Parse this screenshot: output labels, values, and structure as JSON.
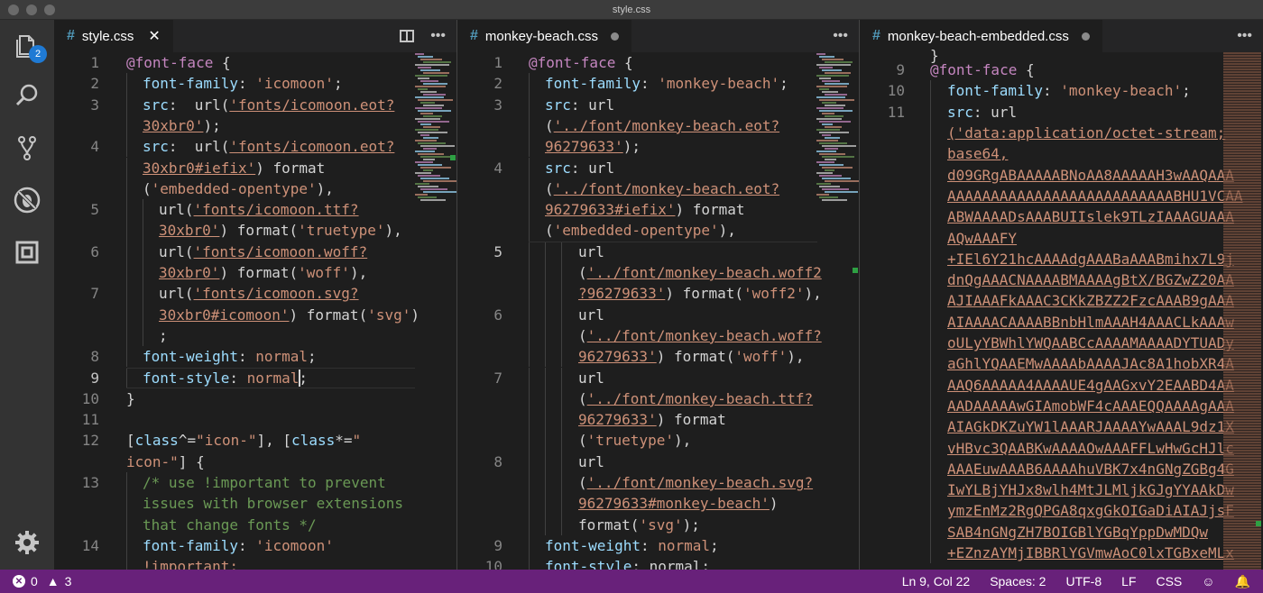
{
  "window": {
    "title": "style.css"
  },
  "activity": {
    "source_control_badge": "2"
  },
  "groups": [
    {
      "tab": {
        "label": "style.css",
        "close": "✕"
      },
      "lines": [
        {
          "n": "1"
        },
        {
          "n": "2"
        },
        {
          "n": "3"
        },
        {
          "n": ""
        },
        {
          "n": "4"
        },
        {
          "n": ""
        },
        {
          "n": ""
        },
        {
          "n": "5"
        },
        {
          "n": ""
        },
        {
          "n": "6"
        },
        {
          "n": ""
        },
        {
          "n": "7"
        },
        {
          "n": ""
        },
        {
          "n": ""
        },
        {
          "n": "8"
        },
        {
          "n": "9"
        },
        {
          "n": "10"
        },
        {
          "n": "11"
        },
        {
          "n": "12"
        },
        {
          "n": ""
        },
        {
          "n": "13"
        },
        {
          "n": ""
        },
        {
          "n": ""
        },
        {
          "n": "14"
        },
        {
          "n": ""
        }
      ]
    },
    {
      "tab": {
        "label": "monkey-beach.css"
      },
      "lines": [
        {
          "n": "1"
        },
        {
          "n": "2"
        },
        {
          "n": "3"
        },
        {
          "n": ""
        },
        {
          "n": ""
        },
        {
          "n": "4"
        },
        {
          "n": ""
        },
        {
          "n": ""
        },
        {
          "n": ""
        },
        {
          "n": "5"
        },
        {
          "n": ""
        },
        {
          "n": ""
        },
        {
          "n": "6"
        },
        {
          "n": ""
        },
        {
          "n": ""
        },
        {
          "n": "7"
        },
        {
          "n": ""
        },
        {
          "n": ""
        },
        {
          "n": ""
        },
        {
          "n": "8"
        },
        {
          "n": ""
        },
        {
          "n": ""
        },
        {
          "n": ""
        },
        {
          "n": "9"
        },
        {
          "n": "10"
        }
      ]
    },
    {
      "tab": {
        "label": "monkey-beach-embedded.css"
      },
      "lines": [
        {
          "n": "9"
        },
        {
          "n": "10"
        },
        {
          "n": "11"
        }
      ]
    }
  ],
  "code1": {
    "l1a": "@font-face",
    "l1b": " {",
    "l2a": "font-family",
    "l2b": ": ",
    "l2c": "'icomoon'",
    "l2d": ";",
    "l3a": "src",
    "l3b": ":  url(",
    "l3c": "'fonts/icomoon.eot?",
    "l3d": "30xbr0'",
    "l3e": ");",
    "l4a": "src",
    "l4b": ":  url(",
    "l4c": "'fonts/icomoon.eot?",
    "l4d": "30xbr0#iefix'",
    "l4e": ") format",
    "l4f": "(",
    "l4g": "'embedded-opentype'",
    "l4h": "),",
    "l5a": "url(",
    "l5b": "'fonts/icomoon.ttf?",
    "l5c": "30xbr0'",
    "l5d": ") format(",
    "l5e": "'truetype'",
    "l5f": "),",
    "l6a": "url(",
    "l6b": "'fonts/icomoon.woff?",
    "l6c": "30xbr0'",
    "l6d": ") format(",
    "l6e": "'woff'",
    "l6f": "),",
    "l7a": "url(",
    "l7b": "'fonts/icomoon.svg?",
    "l7c": "30xbr0#icomoon'",
    "l7d": ") format(",
    "l7e": "'svg'",
    "l7f": ")",
    "l7g": ";",
    "l8a": "font-weight",
    "l8b": ": ",
    "l8c": "normal",
    "l8d": ";",
    "l9a": "font-style",
    "l9b": ": ",
    "l9c": "normal",
    "l9d": ";",
    "l10": "}",
    "l12a": "[",
    "l12b": "class",
    "l12c": "^=",
    "l12d": "\"icon-\"",
    "l12e": "], [",
    "l12f": "class",
    "l12g": "*=",
    "l12h": "\"",
    "l12i": "icon-\"",
    "l12j": "] {",
    "l13a": "/* use !important to prevent",
    "l13b": "issues with browser extensions",
    "l13c": "that change fonts */",
    "l14a": "font-family",
    "l14b": ": ",
    "l14c": "'icomoon'",
    "l14d": "!important;"
  },
  "code2": {
    "l1a": "@font-face",
    "l1b": " {",
    "l2a": "font-family",
    "l2b": ": ",
    "l2c": "'monkey-beach'",
    "l2d": ";",
    "l3a": "src",
    "l3b": ": url",
    "l3c": "(",
    "l3d": "'../font/monkey-beach.eot?",
    "l3e": "96279633'",
    "l3f": ");",
    "l4a": "src",
    "l4b": ": url",
    "l4c": "(",
    "l4d": "'../font/monkey-beach.eot?",
    "l4e": "96279633#iefix'",
    "l4f": ") format",
    "l4g": "(",
    "l4h": "'embedded-opentype'",
    "l4i": "),",
    "l5a": "url",
    "l5b": "(",
    "l5c": "'../font/monkey-beach.woff2",
    "l5d": "?96279633'",
    "l5e": ") format(",
    "l5f": "'woff2'",
    "l5g": "),",
    "l6a": "url",
    "l6b": "(",
    "l6c": "'../font/monkey-beach.woff?",
    "l6d": "96279633'",
    "l6e": ") format(",
    "l6f": "'woff'",
    "l6g": "),",
    "l7a": "url",
    "l7b": "(",
    "l7c": "'../font/monkey-beach.ttf?",
    "l7d": "96279633'",
    "l7e": ") format",
    "l7f": "(",
    "l7g": "'truetype'",
    "l7h": "),",
    "l8a": "url",
    "l8b": "(",
    "l8c": "'../font/monkey-beach.svg?",
    "l8d": "96279633#monkey-beach'",
    "l8e": ")",
    "l8f": "format(",
    "l8g": "'svg'",
    "l8h": ");",
    "l9a": "font-weight",
    "l9b": ": ",
    "l9c": "normal",
    "l9d": ";",
    "l10a": "font-style",
    "l10b": ": normal;"
  },
  "code3": {
    "top": "}",
    "l9a": "@font-face",
    "l9b": " {",
    "l10a": "font-family",
    "l10b": ": ",
    "l10c": "'monkey-beach'",
    "l10d": ";",
    "l11a": "src",
    "l11b": ": url",
    "data": [
      "('data:application/octet-stream;",
      "base64,",
      "d09GRgABAAAAABNoAA8AAAAAH3wAAQAAA",
      "AAAAAAAAAAAAAAAAAAAAAAAAAABHU1VCAA",
      "ABWAAAADsAAABUIIslek9TLzIAAAGUAAA",
      "AQwAAAFY",
      "+IEl6Y21hcAAAAdgAAABaAAABmihx7L9j",
      "dnQgAAACNAAAABMAAAAgBtX/BGZwZ20AA",
      "AJIAAAFkAAAC3CKkZBZZ2FzcAAAB9gAAA",
      "AIAAAACAAAABBnbHlmAAAH4AAACLkAAAw",
      "oULyYBWhlYWQAABCcAAAAMAAAADYTUADy",
      "aGhlYQAAEMwAAAAbAAAAJAc8A1hobXR4A",
      "AAQ6AAAAA4AAAAUE4gAAGxvY2EAABD4AA",
      "AADAAAAAwGIAmobWF4cAAAEQQAAAAgAAA",
      "AIAGkDKZuYW1lAAARJAAAAYwAAAL9dz1X",
      "vHBvc3QAABKwAAAAOwAAAFFLwHwGcHJlc",
      "AAAEuwAAAB6AAAAhuVBK7x4nGNgZGBg4G",
      "IwYLBjYHJx8wlh4MtJLMljkGJgYYAAkDw",
      "ymzEnMz2RgQPGA8qxgGkOIGaDiAIAJjsF",
      "SAB4nGNgZH7BOIGBlYGBqYppDwMDQw",
      "+EZnzAYMjIBBRlYGVmwAoC0lxTGBxeMLx"
    ]
  },
  "status": {
    "errors": "0",
    "warnings": "3",
    "position": "Ln 9, Col 22",
    "spaces": "Spaces: 2",
    "encoding": "UTF-8",
    "eol": "LF",
    "language": "CSS"
  }
}
